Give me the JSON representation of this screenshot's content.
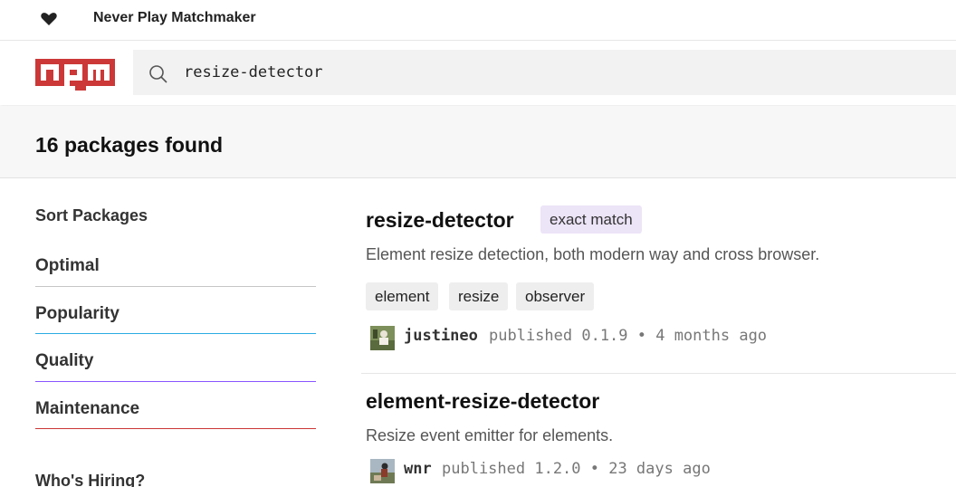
{
  "topbar": {
    "tagline": "Never Play Matchmaker",
    "icon": "heart-icon"
  },
  "header": {
    "logo_text": "npm",
    "logo_color": "#cb3837"
  },
  "search": {
    "value": "resize-detector",
    "icon": "search-icon"
  },
  "results": {
    "count_text": "16 packages found"
  },
  "sidebar": {
    "heading": "Sort Packages",
    "items": [
      {
        "label": "Optimal",
        "color": "#c6c6c6"
      },
      {
        "label": "Popularity",
        "color": "#29abe2"
      },
      {
        "label": "Quality",
        "color": "#8956ff"
      },
      {
        "label": "Maintenance",
        "color": "#cb3837"
      }
    ],
    "hiring": "Who's Hiring?"
  },
  "packages": [
    {
      "name": "resize-detector",
      "badge": "exact match",
      "description": "Element resize detection, both modern way and cross browser.",
      "keywords": [
        "element",
        "resize",
        "observer"
      ],
      "author": "justineo",
      "published": "published 0.1.9 • 4 months ago"
    },
    {
      "name": "element-resize-detector",
      "description": "Resize event emitter for elements.",
      "author": "wnr",
      "published": "published 1.2.0 • 23 days ago"
    }
  ]
}
